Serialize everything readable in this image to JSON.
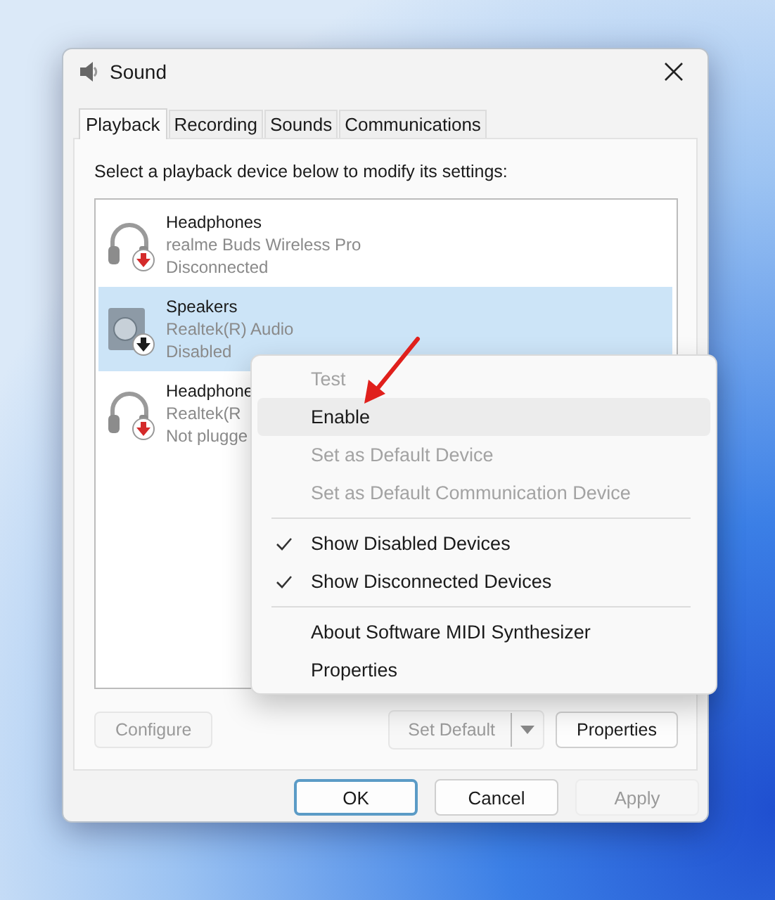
{
  "window": {
    "title": "Sound"
  },
  "tabs": [
    {
      "label": "Playback",
      "selected": true
    },
    {
      "label": "Recording",
      "selected": false
    },
    {
      "label": "Sounds",
      "selected": false
    },
    {
      "label": "Communications",
      "selected": false
    }
  ],
  "instruction": "Select a playback device below to modify its settings:",
  "devices": [
    {
      "kind": "headphones",
      "name": "Headphones",
      "driver": "realme Buds Wireless Pro",
      "status": "Disconnected",
      "color": "#d42a2a",
      "selected": false
    },
    {
      "kind": "speaker",
      "name": "Speakers",
      "driver": "Realtek(R) Audio",
      "status": "Disabled",
      "color": "#1a1a1a",
      "selected": true
    },
    {
      "kind": "headphones",
      "name": "Headphone",
      "driver": "Realtek(R",
      "status": "Not plugge",
      "color": "#d42a2a",
      "selected": false
    }
  ],
  "context_menu": [
    {
      "kind": "item",
      "label": "Test",
      "disabled": true,
      "checked": false,
      "selected": false
    },
    {
      "kind": "item",
      "label": "Enable",
      "disabled": false,
      "checked": false,
      "selected": true
    },
    {
      "kind": "item",
      "label": "Set as Default Device",
      "disabled": true,
      "checked": false,
      "selected": false
    },
    {
      "kind": "item",
      "label": "Set as Default Communication Device",
      "disabled": true,
      "checked": false,
      "selected": false
    },
    {
      "kind": "separator"
    },
    {
      "kind": "item",
      "label": "Show Disabled Devices",
      "disabled": false,
      "checked": true,
      "selected": false
    },
    {
      "kind": "item",
      "label": "Show Disconnected Devices",
      "disabled": false,
      "checked": true,
      "selected": false
    },
    {
      "kind": "separator"
    },
    {
      "kind": "item",
      "label": "About Software MIDI Synthesizer",
      "disabled": false,
      "checked": false,
      "selected": false
    },
    {
      "kind": "item",
      "label": "Properties",
      "disabled": false,
      "checked": false,
      "selected": false
    }
  ],
  "panel_buttons": {
    "configure": {
      "label": "Configure",
      "disabled": true
    },
    "set_default": {
      "label": "Set Default",
      "disabled": true
    },
    "properties": {
      "label": "Properties",
      "disabled": false
    }
  },
  "dialog_buttons": [
    {
      "label": "OK",
      "disabled": false,
      "default": true
    },
    {
      "label": "Cancel",
      "disabled": false,
      "default": false
    },
    {
      "label": "Apply",
      "disabled": true,
      "default": false
    }
  ]
}
